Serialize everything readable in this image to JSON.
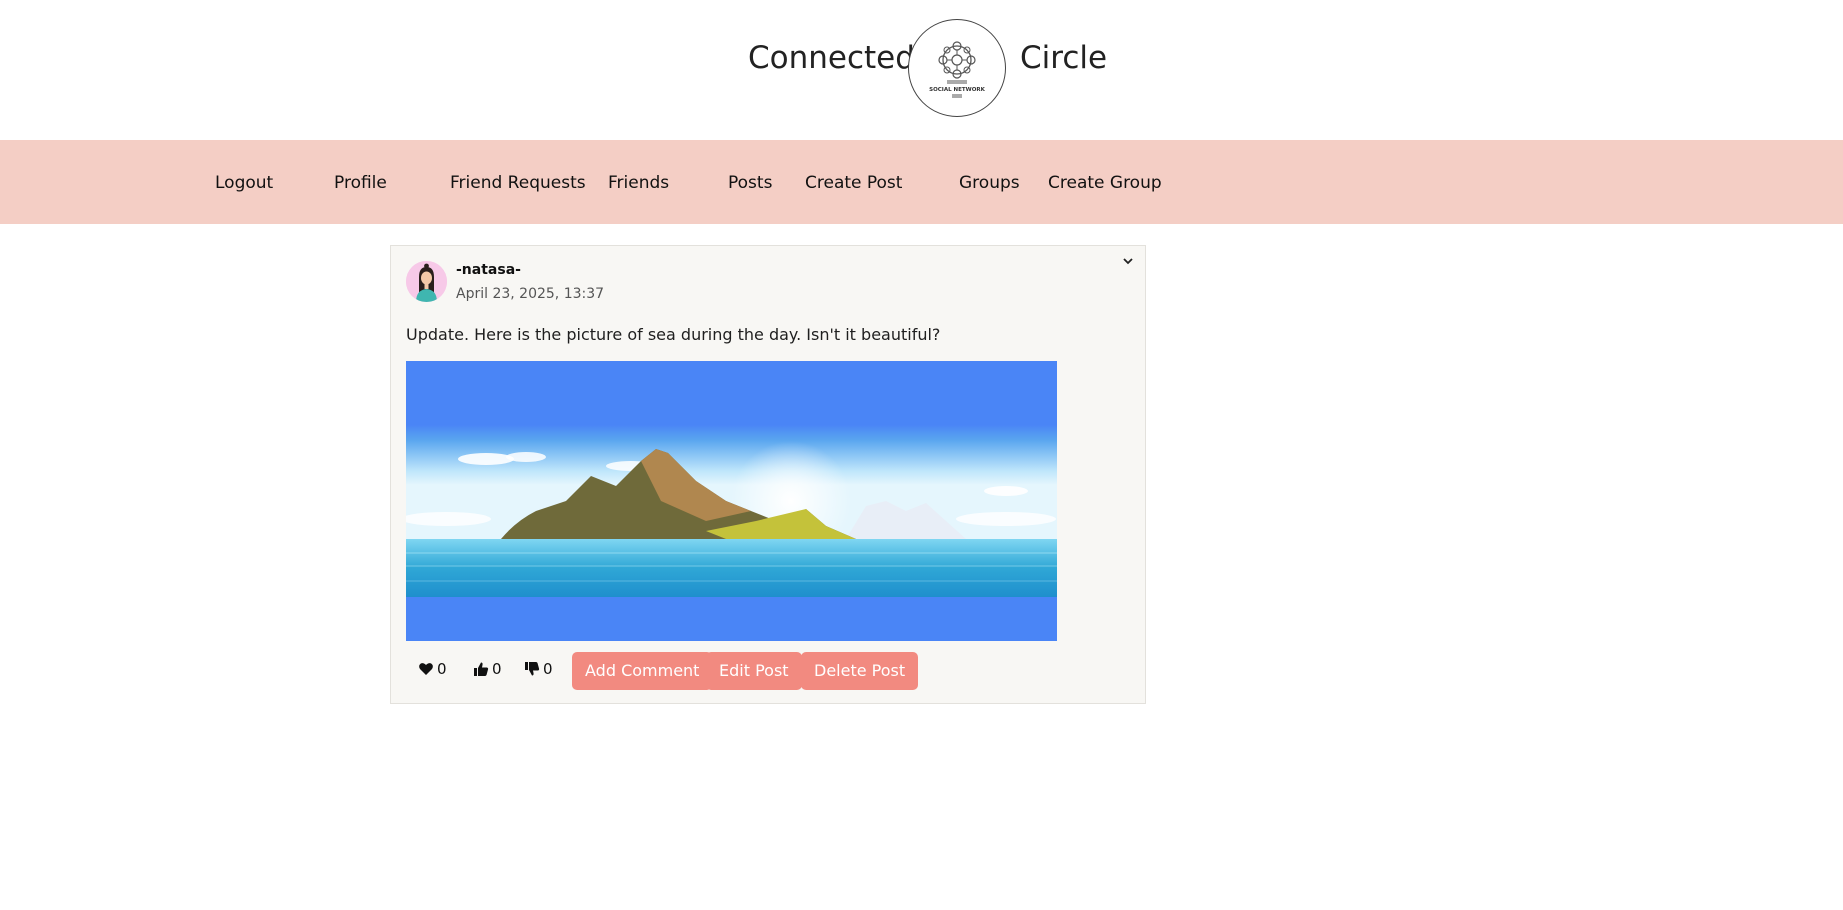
{
  "header": {
    "brand_left": "Connected",
    "brand_right": "Circle",
    "logo_icon": "social-network-logo-icon",
    "logo_text_line": "SOCIAL NETWORK"
  },
  "nav": {
    "items": [
      {
        "label": "Logout"
      },
      {
        "label": "Profile"
      },
      {
        "label": "Friend Requests"
      },
      {
        "label": "Friends"
      },
      {
        "label": "Posts"
      },
      {
        "label": "Create Post"
      },
      {
        "label": "Groups"
      },
      {
        "label": "Create Group"
      }
    ]
  },
  "post": {
    "username": "-natasa-",
    "timestamp": "April 23, 2025, 13:37",
    "text": "Update. Here is the picture of sea during the day. Isn't it beautiful?",
    "image_icon": "sea-island-landscape-image",
    "reactions": {
      "hearts": "0",
      "likes": "0",
      "dislikes": "0"
    },
    "actions": {
      "add_comment": "Add Comment",
      "edit_post": "Edit Post",
      "delete_post": "Delete Post"
    }
  },
  "colors": {
    "navbar_bg": "#f4cec5",
    "button_bg": "#f28a80",
    "card_bg": "#f8f7f4",
    "image_sky": "#4a85f6"
  }
}
